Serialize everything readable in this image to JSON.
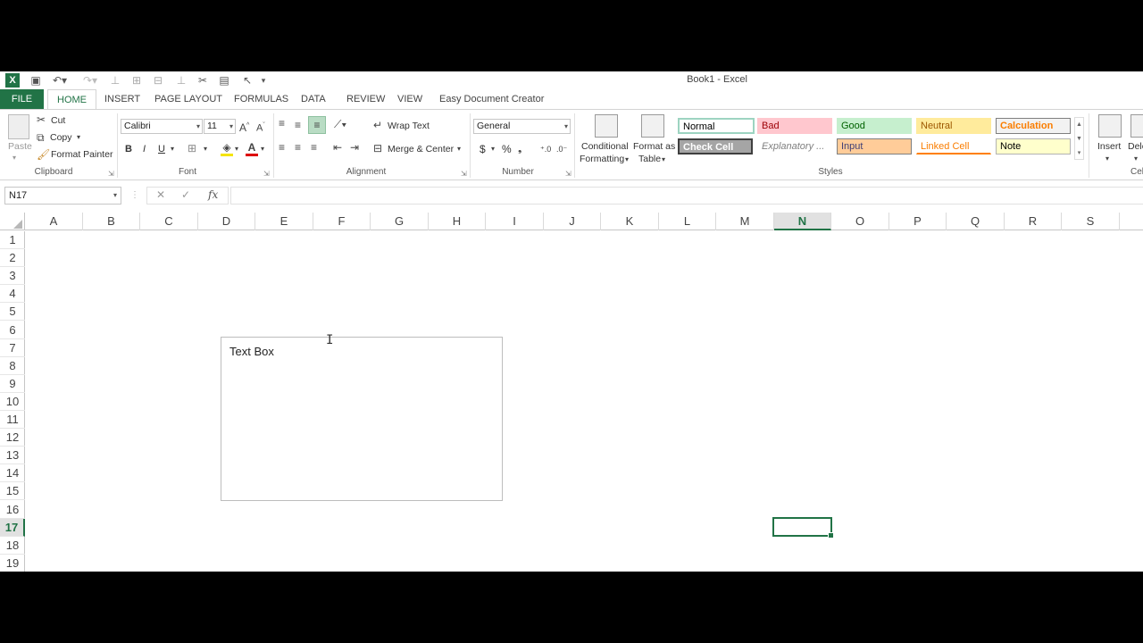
{
  "window": {
    "title": "Book1 - Excel"
  },
  "tabs": [
    {
      "label": "FILE"
    },
    {
      "label": "HOME"
    },
    {
      "label": "INSERT"
    },
    {
      "label": "PAGE LAYOUT"
    },
    {
      "label": "FORMULAS"
    },
    {
      "label": "DATA"
    },
    {
      "label": "REVIEW"
    },
    {
      "label": "VIEW"
    },
    {
      "label": "Easy Document Creator"
    }
  ],
  "clipboard": {
    "paste": "Paste",
    "cut": "Cut",
    "copy": "Copy",
    "format_painter": "Format Painter",
    "label": "Clipboard"
  },
  "font": {
    "name": "Calibri",
    "size": "11",
    "bold": "B",
    "italic": "I",
    "underline": "U",
    "label": "Font"
  },
  "alignment": {
    "wrap_text": "Wrap Text",
    "merge_center": "Merge & Center",
    "label": "Alignment"
  },
  "number": {
    "format": "General",
    "currency": "$",
    "percent": "%",
    "label": "Number"
  },
  "styles": {
    "conditional": [
      "Conditional",
      "Formatting"
    ],
    "format_table": [
      "Format as",
      "Table"
    ],
    "label": "Styles",
    "items": [
      {
        "label": "Normal"
      },
      {
        "label": "Bad"
      },
      {
        "label": "Good"
      },
      {
        "label": "Neutral"
      },
      {
        "label": "Calculation"
      },
      {
        "label": "Check Cell"
      },
      {
        "label": "Explanatory ..."
      },
      {
        "label": "Input"
      },
      {
        "label": "Linked Cell"
      },
      {
        "label": "Note"
      }
    ]
  },
  "cells_group": {
    "insert": "Insert",
    "delete": "Dele",
    "label": "Cel"
  },
  "formula_bar": {
    "name_box": "N17",
    "fx": "fx",
    "value": ""
  },
  "columns": [
    "A",
    "B",
    "C",
    "D",
    "E",
    "F",
    "G",
    "H",
    "I",
    "J",
    "K",
    "L",
    "M",
    "N",
    "O",
    "P",
    "Q",
    "R",
    "S"
  ],
  "rows": [
    "1",
    "2",
    "3",
    "4",
    "5",
    "6",
    "7",
    "8",
    "9",
    "10",
    "11",
    "12",
    "13",
    "14",
    "15",
    "16",
    "17",
    "18",
    "19"
  ],
  "selected": {
    "column": "N",
    "row": "17"
  },
  "text_box": {
    "text": "Text Box"
  },
  "colors": {
    "accent": "#217346"
  }
}
